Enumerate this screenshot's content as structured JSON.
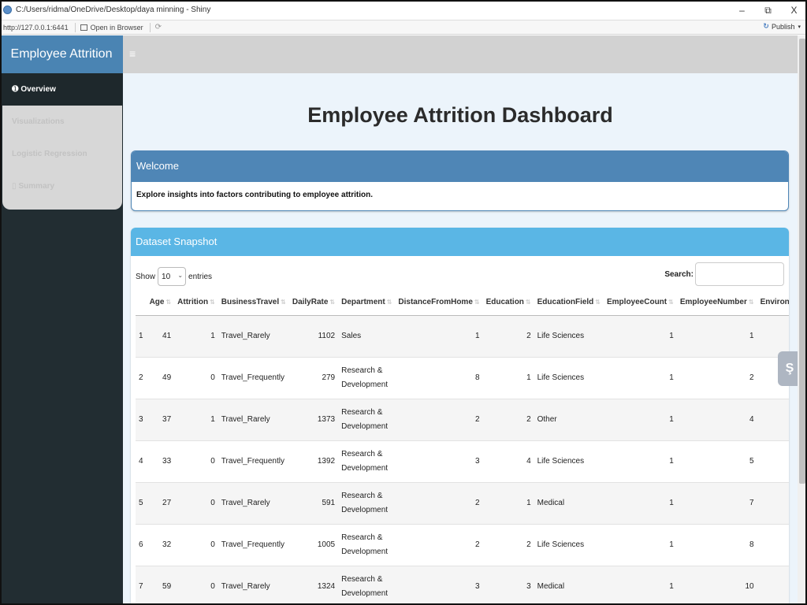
{
  "window": {
    "title": "C:/Users/ridma/OneDrive/Desktop/daya minning - Shiny",
    "minimize": "–",
    "restore": "⧉",
    "close": "X"
  },
  "addressbar": {
    "url": "http://127.0.0.1:6441",
    "open_in_browser": "Open in Browser",
    "publish": "Publish"
  },
  "header": {
    "brand": "Employee Attrition",
    "menu_toggle": "≡"
  },
  "sidebar": {
    "items": [
      {
        "icon": "➊",
        "label": "Overview"
      },
      {
        "icon": "",
        "label": "Visualizations"
      },
      {
        "icon": "",
        "label": "Logistic Regression"
      },
      {
        "icon": "▯",
        "label": "Summary"
      }
    ]
  },
  "main": {
    "title": "Employee Attrition Dashboard",
    "welcome": {
      "header": "Welcome",
      "body": "Explore insights into factors contributing to employee attrition."
    },
    "snapshot": {
      "header": "Dataset Snapshot",
      "show_label": "Show",
      "entries_value": "10",
      "entries_label": "entries",
      "search_label": "Search:",
      "search_value": "",
      "columns": [
        "",
        "Age",
        "Attrition",
        "BusinessTravel",
        "DailyRate",
        "Department",
        "DistanceFromHome",
        "Education",
        "EducationField",
        "EmployeeCount",
        "EmployeeNumber",
        "Environme"
      ],
      "rows": [
        [
          "1",
          "41",
          "1",
          "Travel_Rarely",
          "1102",
          "Sales",
          "1",
          "2",
          "Life Sciences",
          "1",
          "1",
          ""
        ],
        [
          "2",
          "49",
          "0",
          "Travel_Frequently",
          "279",
          "Research & Development",
          "8",
          "1",
          "Life Sciences",
          "1",
          "2",
          ""
        ],
        [
          "3",
          "37",
          "1",
          "Travel_Rarely",
          "1373",
          "Research & Development",
          "2",
          "2",
          "Other",
          "1",
          "4",
          ""
        ],
        [
          "4",
          "33",
          "0",
          "Travel_Frequently",
          "1392",
          "Research & Development",
          "3",
          "4",
          "Life Sciences",
          "1",
          "5",
          ""
        ],
        [
          "5",
          "27",
          "0",
          "Travel_Rarely",
          "591",
          "Research & Development",
          "2",
          "1",
          "Medical",
          "1",
          "7",
          ""
        ],
        [
          "6",
          "32",
          "0",
          "Travel_Frequently",
          "1005",
          "Research & Development",
          "2",
          "2",
          "Life Sciences",
          "1",
          "8",
          ""
        ],
        [
          "7",
          "59",
          "0",
          "Travel_Rarely",
          "1324",
          "Research & Development",
          "3",
          "3",
          "Medical",
          "1",
          "10",
          ""
        ]
      ]
    }
  },
  "colors": {
    "brand_bg": "#4a84b3",
    "sidebar_bg": "#222d32",
    "welcome_header": "#4f86b6",
    "snapshot_header": "#5ab6e5"
  },
  "floating_button": {
    "icon": "shiny-reload-icon",
    "glyph": "Ş"
  }
}
